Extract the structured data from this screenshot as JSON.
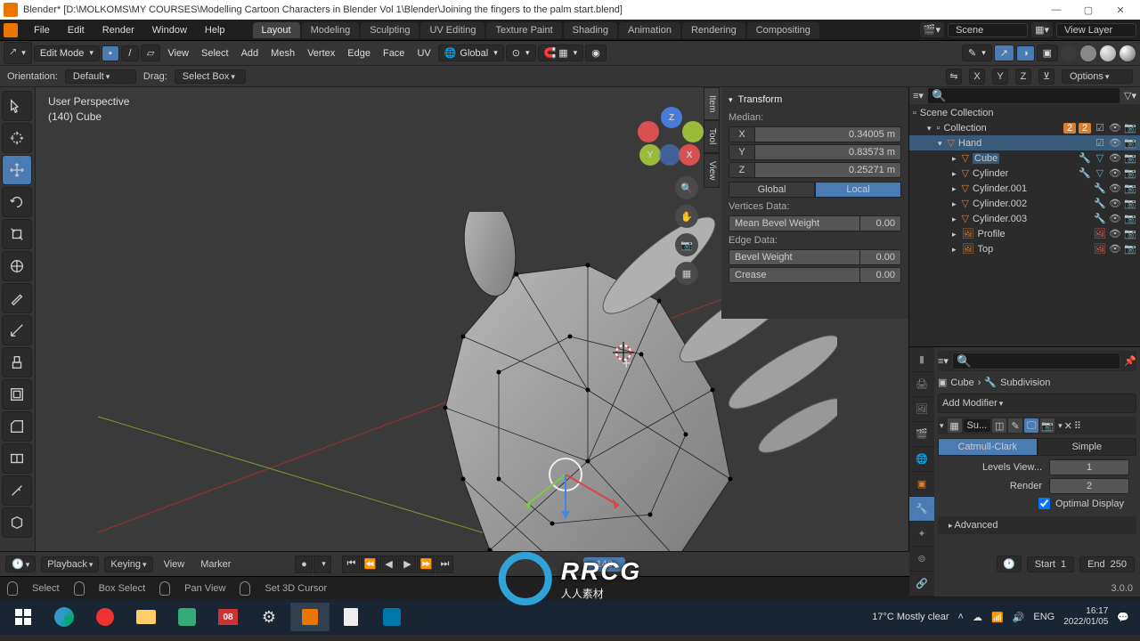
{
  "window": {
    "app": "Blender*",
    "path": "[D:\\MOLKOMS\\MY COURSES\\Modelling Cartoon Characters in Blender Vol 1\\Blender\\Joining the fingers to the palm start.blend]"
  },
  "menus": [
    "File",
    "Edit",
    "Render",
    "Window",
    "Help"
  ],
  "workspace_tabs": [
    "Layout",
    "Modeling",
    "Sculpting",
    "UV Editing",
    "Texture Paint",
    "Shading",
    "Animation",
    "Rendering",
    "Compositing"
  ],
  "active_workspace": "Layout",
  "header_right": {
    "scene": "Scene",
    "view_layer": "View Layer"
  },
  "toolbar": {
    "mode": "Edit Mode",
    "menus": [
      "View",
      "Select",
      "Add",
      "Mesh",
      "Vertex",
      "Edge",
      "Face",
      "UV"
    ],
    "orientation": "Global"
  },
  "subbar": {
    "orientation_label": "Orientation:",
    "orientation_value": "Default",
    "drag_label": "Drag:",
    "drag_value": "Select Box",
    "axes": [
      "X",
      "Y",
      "Z"
    ],
    "options": "Options"
  },
  "overlay": {
    "line1": "User Perspective",
    "line2": "(140) Cube"
  },
  "navball": {
    "x": "X",
    "y": "Y",
    "z": "Z"
  },
  "ntabs": [
    "Item",
    "Tool",
    "View"
  ],
  "npanel": {
    "title": "Transform",
    "median_label": "Median:",
    "coords": [
      {
        "axis": "X",
        "val": "0.34005 m"
      },
      {
        "axis": "Y",
        "val": "0.83573 m"
      },
      {
        "axis": "Z",
        "val": "0.25271 m"
      }
    ],
    "space": {
      "global": "Global",
      "local": "Local"
    },
    "verts_label": "Vertices Data:",
    "mean_bevel": {
      "label": "Mean Bevel Weight",
      "val": "0.00"
    },
    "edge_label": "Edge Data:",
    "bevel": {
      "label": "Bevel Weight",
      "val": "0.00"
    },
    "crease": {
      "label": "Crease",
      "val": "0.00"
    }
  },
  "outliner": {
    "root": "Scene Collection",
    "collection": {
      "name": "Collection",
      "badges": [
        "2",
        "2"
      ]
    },
    "nodes": [
      {
        "name": "Hand",
        "depth": 1,
        "open": true,
        "sel": true,
        "type": "mesh"
      },
      {
        "name": "Cube",
        "depth": 2,
        "type": "mesh",
        "sel_inner": true
      },
      {
        "name": "Cylinder",
        "depth": 2,
        "type": "mesh"
      },
      {
        "name": "Cylinder.001",
        "depth": 2,
        "type": "mesh"
      },
      {
        "name": "Cylinder.002",
        "depth": 2,
        "type": "mesh"
      },
      {
        "name": "Cylinder.003",
        "depth": 2,
        "type": "mesh"
      },
      {
        "name": "Profile",
        "depth": 2,
        "type": "image"
      },
      {
        "name": "Top",
        "depth": 2,
        "type": "image"
      }
    ]
  },
  "properties": {
    "breadcrumb": {
      "obj": "Cube",
      "mod": "Subdivision"
    },
    "add_modifier": "Add Modifier",
    "mod_name": "Su...",
    "subdiv_tabs": {
      "catmull": "Catmull-Clark",
      "simple": "Simple"
    },
    "levels_view": {
      "label": "Levels View...",
      "val": "1"
    },
    "render": {
      "label": "Render",
      "val": "2"
    },
    "optimal": "Optimal Display",
    "advanced": "Advanced"
  },
  "timeline": {
    "playback": "Playback",
    "keying": "Keying",
    "view": "View",
    "marker": "Marker",
    "current": "140",
    "start_label": "Start",
    "start": "1",
    "end_label": "End",
    "end": "250"
  },
  "statusbar": {
    "select": "Select",
    "box_select": "Box Select",
    "pan": "Pan View",
    "cursor": "Set 3D Cursor",
    "version": "3.0.0"
  },
  "taskbar": {
    "weather": "17°C  Mostly clear",
    "time": "16:17",
    "date": "2022/01/05"
  },
  "watermark": {
    "main": "RRCG",
    "sub": "人人素材"
  }
}
